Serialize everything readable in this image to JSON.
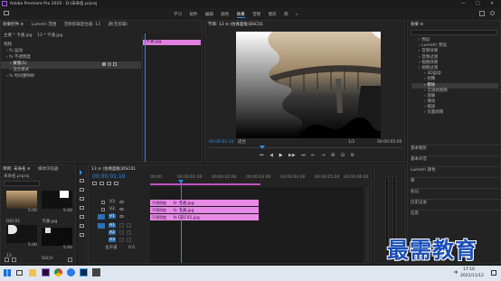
{
  "app": {
    "title": "Adobe Premiere Pro 2020 - D:\\未命名.prproj",
    "window_controls": [
      "—",
      "□",
      "✕"
    ]
  },
  "menu": {
    "items": [
      "学习",
      "组件",
      "编辑",
      "颜色",
      "效果",
      "音频",
      "图形",
      "库"
    ],
    "active_index": 4,
    "more": "»"
  },
  "effect_controls": {
    "tabs": [
      "效果控件 ≡",
      "Lumetri 范围",
      "音频剪辑混合器: 13",
      "源(无剪辑)"
    ],
    "source": "主要 * 卡通.jpg",
    "clip": "13 * 卡通.jpg",
    "video_label": "视频",
    "rows": [
      "› fx 运动",
      "› fx 不透明度",
      "› 蒙版(1)",
      "› 混合模式",
      "› fx 时间重映射"
    ],
    "clip_bar": "卡通.jpg"
  },
  "program": {
    "tab": "节目: 13 ≡ (仿真面板)DSC01",
    "timecode_left": "00:00:01:10",
    "fit": "适合",
    "fraction": "1/2",
    "timecode_right": "00:00:05:00",
    "controls": [
      "⏮",
      "◀",
      "▶",
      "▶▶",
      "⏭",
      "⇤",
      "⇥",
      "⊞",
      "⊟",
      "⚙"
    ]
  },
  "effects_panel": {
    "title": "效果 ≡",
    "items": [
      "› 预设",
      "› Lumetri 预设",
      "› 音频效果",
      "› 音频过渡",
      "› 视频效果",
      "› 视频过渡",
      "› 3D运动",
      "› 划像",
      "› 擦除",
      "› 沉浸式视频",
      "› 溶解",
      "› 滑动",
      "› 缩放",
      "› 页面剥落"
    ],
    "sections": [
      "基本图形",
      "基本声音",
      "Lumetri 颜色",
      "库",
      "标记",
      "历史记录",
      "信息"
    ]
  },
  "project": {
    "tabs": [
      "项目: 未命名 ≡",
      "媒体浏览器"
    ],
    "name": "未命名.prproj",
    "items": [
      {
        "name": "DSC01",
        "duration": "5:00"
      },
      {
        "name": "卡通.jpg",
        "duration": "5:00"
      },
      {
        "name": "13",
        "duration": "5:00"
      },
      {
        "name": "SSCH",
        "duration": "5:00"
      }
    ]
  },
  "timeline": {
    "tab": "13 ≡ (仿真面板)DSC01",
    "timecode": "00:00:01:10",
    "ruler": [
      "00:00",
      "00:00:01:00",
      "00:00:02:00",
      "00:00:03:00",
      "00:00:04:00",
      "00:00:05:00",
      "00:00:06:00"
    ],
    "tracks": [
      {
        "name": "V3",
        "toggle": "V3"
      },
      {
        "name": "V2",
        "toggle": "V2"
      },
      {
        "name": "V1",
        "toggle": "V1"
      },
      {
        "name": "A1",
        "toggle": "A1"
      },
      {
        "name": "A2",
        "toggle": "A2"
      },
      {
        "name": "A3",
        "toggle": "A3"
      }
    ],
    "master": "主声道",
    "master_value": "0.0",
    "clips": [
      {
        "label": "fx 卡通.jpg"
      },
      {
        "label": "fx 卡通.jpg"
      },
      {
        "label": "fx DSC01.jpg"
      }
    ],
    "clip_prefix": [
      "不透明度",
      "不透明度",
      "不透明度"
    ]
  },
  "taskbar": {
    "time": "17:16",
    "date": "2021/11/12",
    "lang": "中"
  },
  "watermark": "最需教育"
}
